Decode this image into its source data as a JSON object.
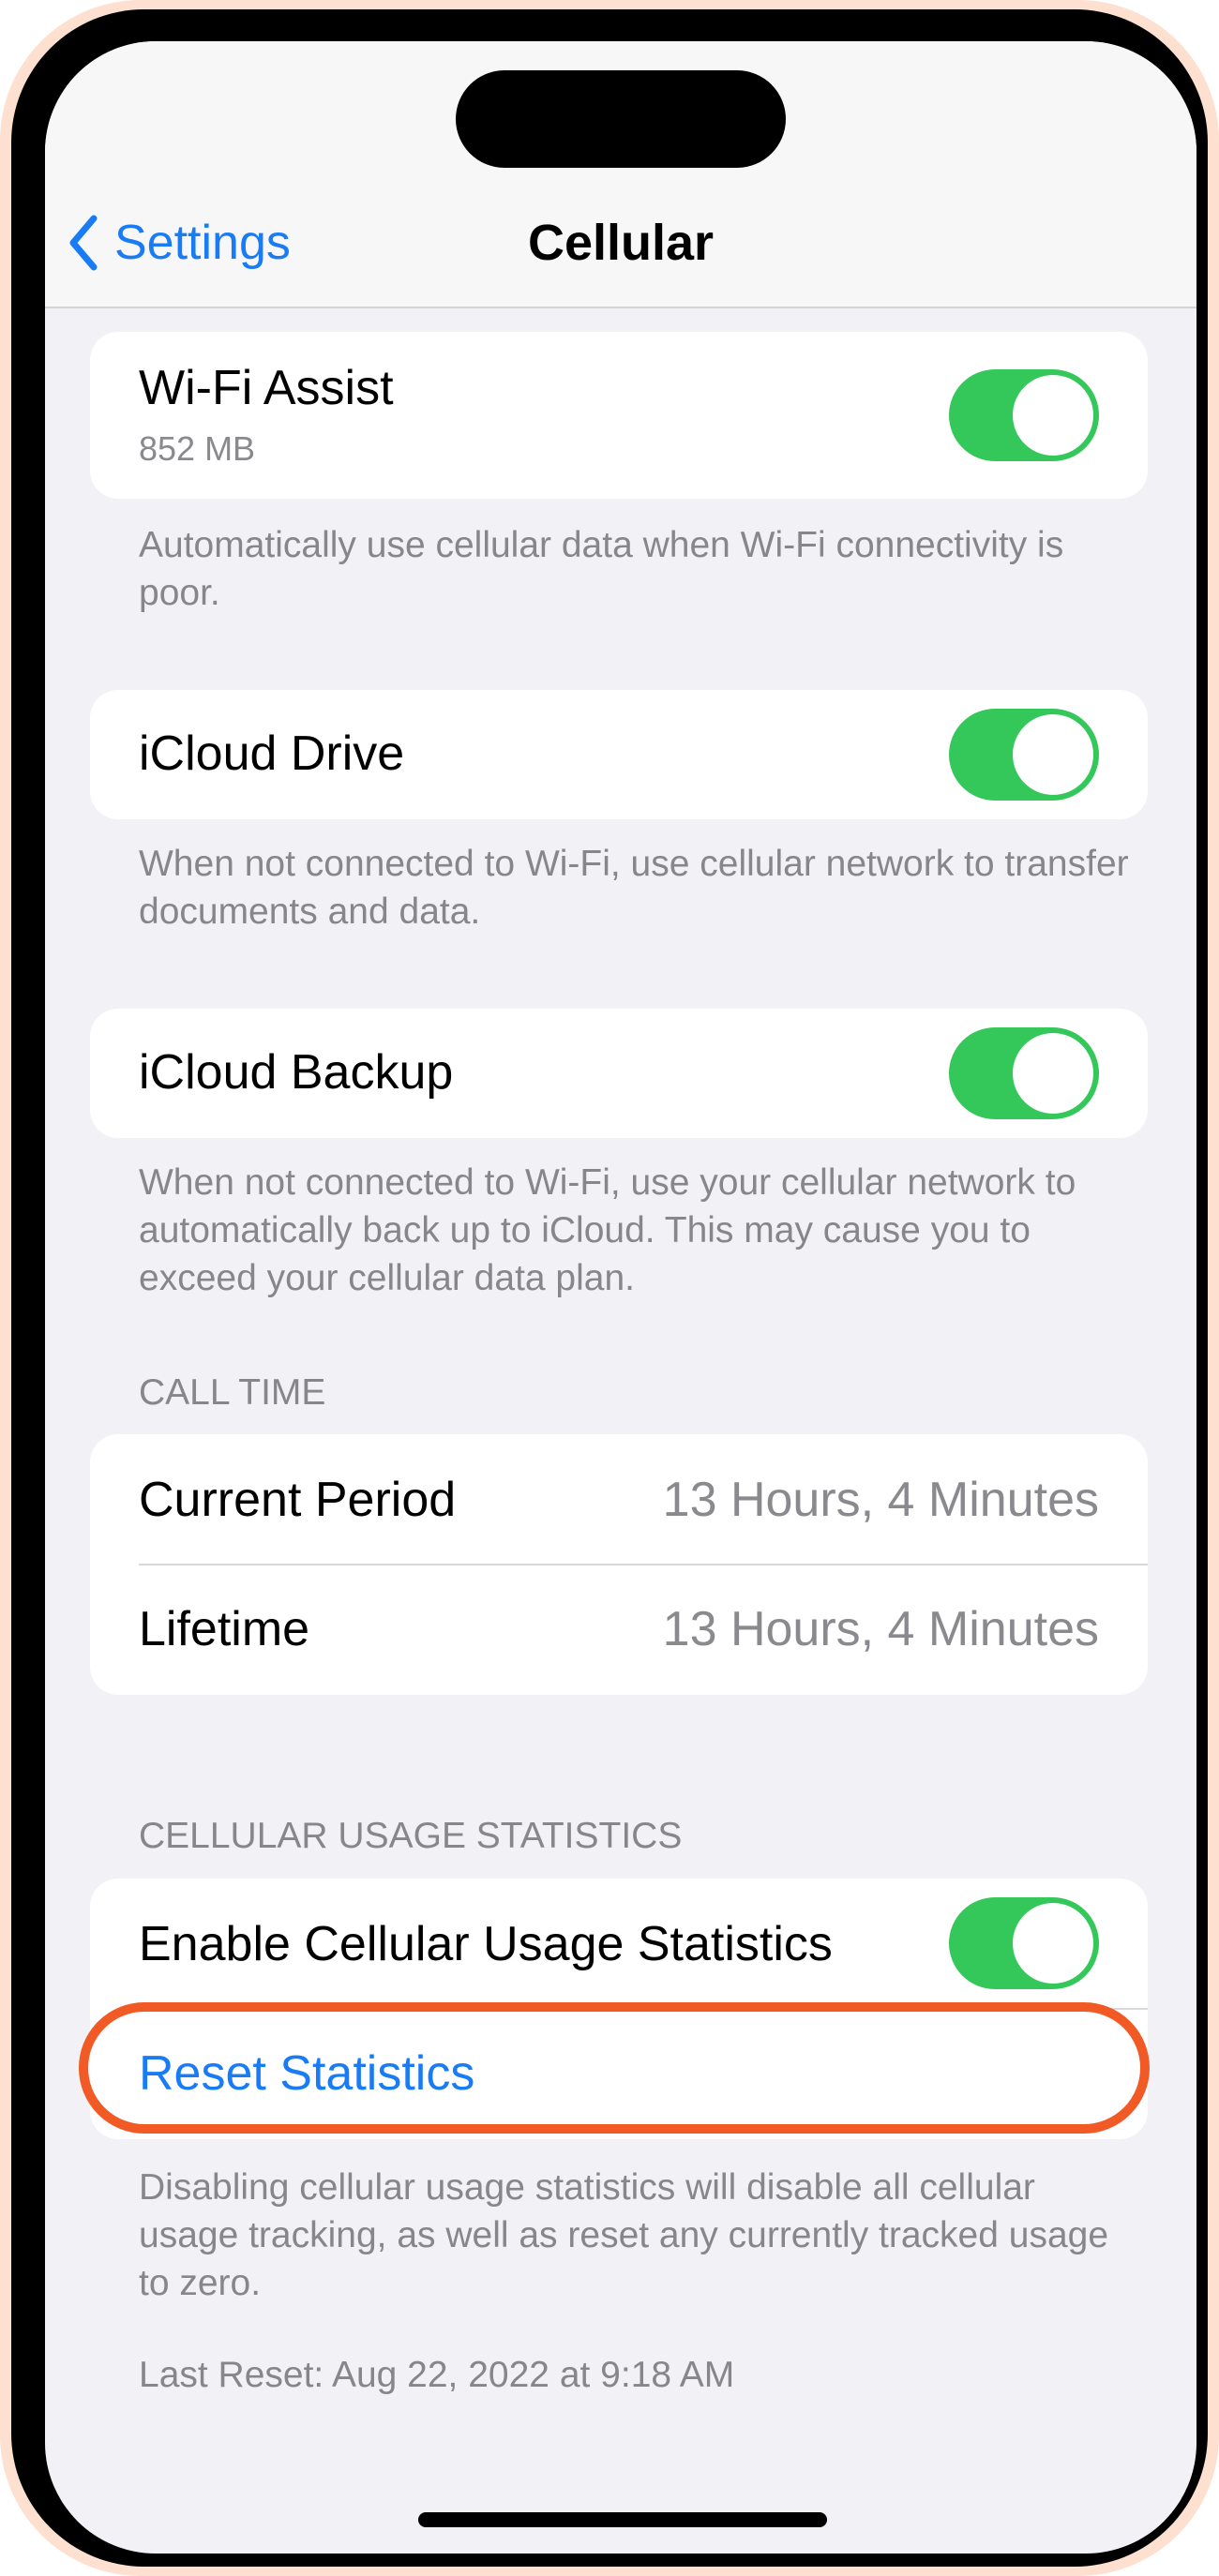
{
  "nav": {
    "back_label": "Settings",
    "title": "Cellular"
  },
  "wifi_assist": {
    "label": "Wi-Fi Assist",
    "usage": "852 MB",
    "enabled": true,
    "footnote": "Automatically use cellular data when Wi-Fi connectivity is poor."
  },
  "icloud_drive": {
    "label": "iCloud Drive",
    "enabled": true,
    "footnote": "When not connected to Wi-Fi, use cellular network to transfer documents and data."
  },
  "icloud_backup": {
    "label": "iCloud Backup",
    "enabled": true,
    "footnote": "When not connected to Wi-Fi, use your cellular network to automatically back up to iCloud. This may cause you to exceed your cellular data plan."
  },
  "call_time": {
    "header": "CALL TIME",
    "rows": [
      {
        "label": "Current Period",
        "value": "13 Hours, 4 Minutes"
      },
      {
        "label": "Lifetime",
        "value": "13 Hours, 4 Minutes"
      }
    ]
  },
  "usage_statistics": {
    "header": "CELLULAR USAGE STATISTICS",
    "enable_label": "Enable Cellular Usage Statistics",
    "enabled": true,
    "reset_label": "Reset Statistics",
    "footnote": "Disabling cellular usage statistics will disable all cellular usage tracking, as well as reset any currently tracked usage to zero.",
    "last_reset": "Last Reset: Aug 22, 2022 at 9:18 AM"
  },
  "colors": {
    "accent": "#1a7cf5",
    "toggle_on": "#34c759",
    "highlight": "#f25a25",
    "frame_outer": "#fde0cf"
  }
}
